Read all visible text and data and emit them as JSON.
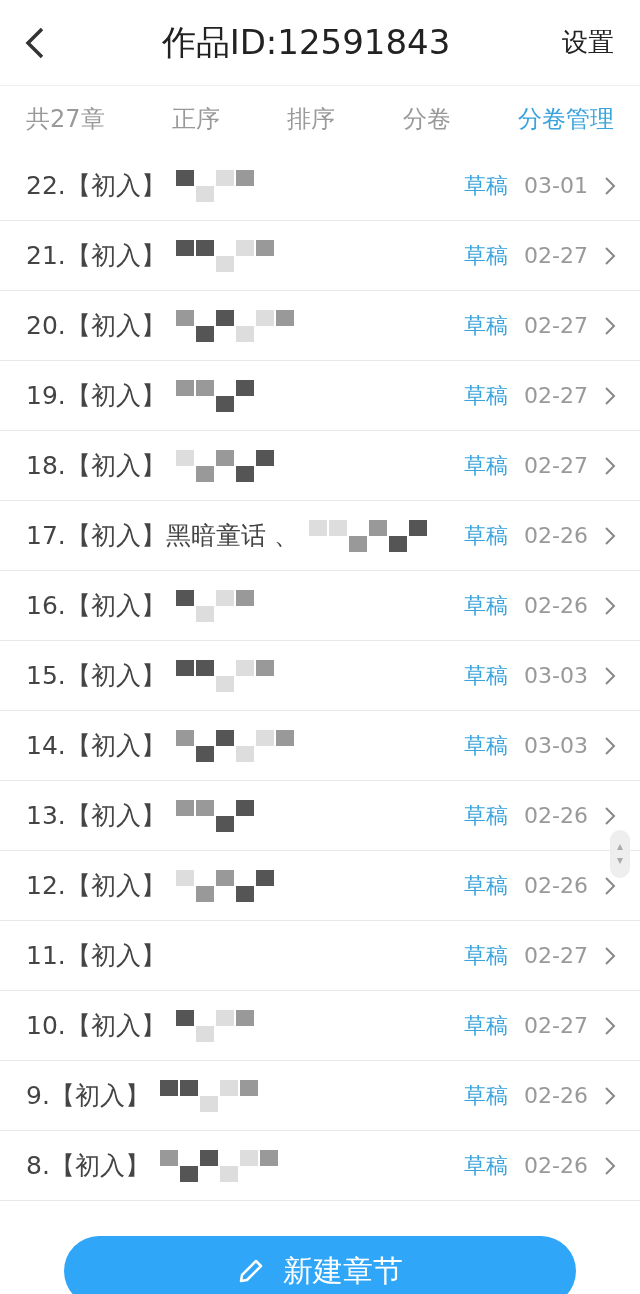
{
  "header": {
    "title": "作品ID:12591843",
    "action": "设置"
  },
  "chapter_count": "共27章",
  "tabs": [
    {
      "label": "正序",
      "selected": false
    },
    {
      "label": "排序",
      "selected": false
    },
    {
      "label": "分卷",
      "selected": false
    },
    {
      "label": "分卷管理",
      "selected": true
    }
  ],
  "chapters": [
    {
      "title": "22.【初入】",
      "redacted": true,
      "status": "草稿",
      "date": "03-01"
    },
    {
      "title": "21.【初入】",
      "redacted": true,
      "status": "草稿",
      "date": "02-27"
    },
    {
      "title": "20.【初入】",
      "redacted": true,
      "status": "草稿",
      "date": "02-27"
    },
    {
      "title": "19.【初入】",
      "redacted": true,
      "status": "草稿",
      "date": "02-27"
    },
    {
      "title": "18.【初入】",
      "redacted": true,
      "status": "草稿",
      "date": "02-27"
    },
    {
      "title": "17.【初入】黑暗童话 、",
      "redacted": true,
      "status": "草稿",
      "date": "02-26"
    },
    {
      "title": "16.【初入】",
      "redacted": true,
      "status": "草稿",
      "date": "02-26"
    },
    {
      "title": "15.【初入】",
      "redacted": true,
      "status": "草稿",
      "date": "03-03"
    },
    {
      "title": "14.【初入】",
      "redacted": true,
      "status": "草稿",
      "date": "03-03"
    },
    {
      "title": "13.【初入】",
      "redacted": true,
      "status": "草稿",
      "date": "02-26"
    },
    {
      "title": "12.【初入】",
      "redacted": true,
      "status": "草稿",
      "date": "02-26"
    },
    {
      "title": "11.【初入】",
      "redacted": false,
      "status": "草稿",
      "date": "02-27"
    },
    {
      "title": "10.【初入】",
      "redacted": true,
      "status": "草稿",
      "date": "02-27"
    },
    {
      "title": "9.【初入】",
      "redacted": true,
      "status": "草稿",
      "date": "02-26"
    },
    {
      "title": "8.【初入】",
      "redacted": true,
      "status": "草稿",
      "date": "02-26"
    }
  ],
  "new_button": {
    "label": "新建章节"
  }
}
